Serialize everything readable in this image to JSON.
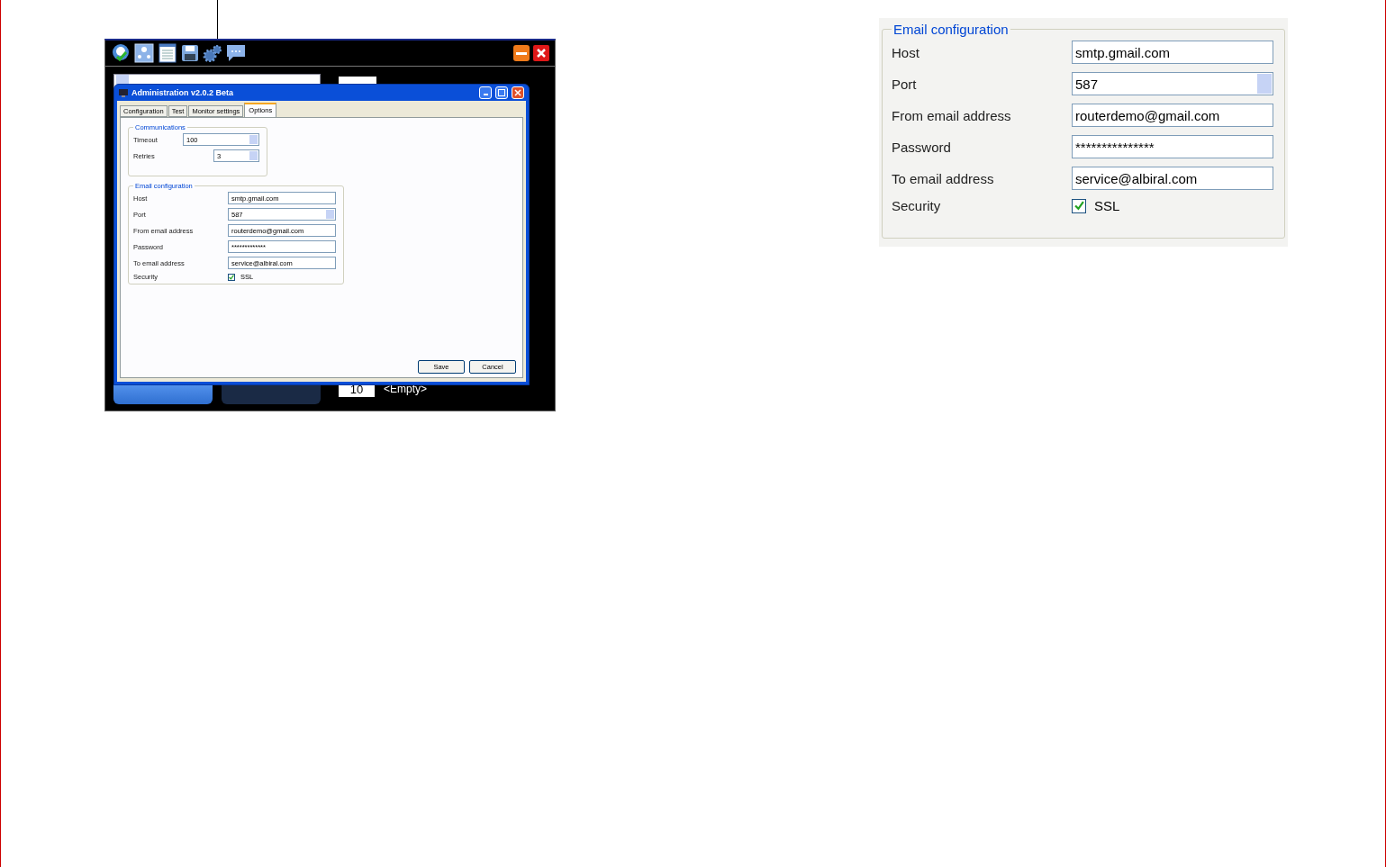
{
  "app_window": {
    "slot_number": "10",
    "slot_status": "<Empty>"
  },
  "dialog": {
    "title": "Administration v2.0.2 Beta",
    "tabs": [
      {
        "label": "Configuration",
        "selected": false
      },
      {
        "label": "Test",
        "selected": false
      },
      {
        "label": "Monitor settings",
        "selected": false
      },
      {
        "label": "Options",
        "selected": true
      }
    ],
    "communications": {
      "title": "Communications",
      "fields": [
        {
          "label": "Timeout",
          "value": "100",
          "kind": "spinner"
        },
        {
          "label": "Retries",
          "value": "3",
          "kind": "small_spinner"
        }
      ]
    },
    "email": {
      "title": "Email configuration",
      "fields": [
        {
          "label": "Host",
          "value": "smtp.gmail.com",
          "kind": "text"
        },
        {
          "label": "Port",
          "value": "587",
          "kind": "spinner"
        },
        {
          "label": "From email address",
          "value": "routerdemo@gmail.com",
          "kind": "text"
        },
        {
          "label": "Password",
          "value": "*************",
          "kind": "password"
        },
        {
          "label": "To email address",
          "value": "service@albiral.com",
          "kind": "text"
        },
        {
          "label": "Security",
          "option": "SSL",
          "checked": true,
          "kind": "checkbox"
        }
      ]
    },
    "buttons": [
      "Save",
      "Cancel"
    ]
  },
  "detail_panel": {
    "title": "Email configuration",
    "fields": [
      {
        "label": "Host",
        "value": "smtp.gmail.com",
        "kind": "text"
      },
      {
        "label": "Port",
        "value": "587",
        "kind": "spinner"
      },
      {
        "label": "From email address",
        "value": "routerdemo@gmail.com",
        "kind": "text"
      },
      {
        "label": "Password",
        "value": "***************",
        "kind": "password"
      },
      {
        "label": "To email address",
        "value": "service@albiral.com",
        "kind": "text"
      },
      {
        "label": "Security",
        "option": "SSL",
        "checked": true,
        "kind": "checkbox"
      }
    ]
  }
}
